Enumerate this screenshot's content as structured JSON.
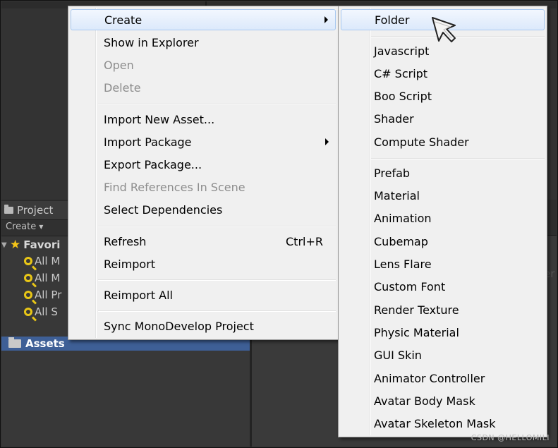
{
  "project_panel": {
    "tab_label": "Project",
    "create_label": "Create",
    "favorites_label": "Favori",
    "favorites_items": [
      "All M",
      "All M",
      "All Pr",
      "All S"
    ],
    "assets_label": "Assets",
    "right_ghost_text": "er"
  },
  "main_menu": {
    "items": [
      {
        "label": "Create",
        "has_submenu": true,
        "highlighted": true,
        "enabled": true
      },
      {
        "label": "Show in Explorer",
        "enabled": true
      },
      {
        "label": "Open",
        "enabled": false
      },
      {
        "label": "Delete",
        "enabled": false
      },
      {
        "label": "Import New Asset...",
        "enabled": true
      },
      {
        "label": "Import Package",
        "has_submenu": true,
        "enabled": true
      },
      {
        "label": "Export Package...",
        "enabled": true
      },
      {
        "label": "Find References In Scene",
        "enabled": false
      },
      {
        "label": "Select Dependencies",
        "enabled": true
      },
      {
        "label": "Refresh",
        "shortcut": "Ctrl+R",
        "enabled": true
      },
      {
        "label": "Reimport",
        "enabled": true
      },
      {
        "label": "Reimport All",
        "enabled": true
      },
      {
        "label": "Sync MonoDevelop Project",
        "enabled": true
      }
    ]
  },
  "create_submenu": {
    "items": [
      {
        "label": "Folder",
        "highlighted": true
      },
      {
        "label": "Javascript"
      },
      {
        "label": "C# Script"
      },
      {
        "label": "Boo Script"
      },
      {
        "label": "Shader"
      },
      {
        "label": "Compute Shader"
      },
      {
        "label": "Prefab"
      },
      {
        "label": "Material"
      },
      {
        "label": "Animation"
      },
      {
        "label": "Cubemap"
      },
      {
        "label": "Lens Flare"
      },
      {
        "label": "Custom Font"
      },
      {
        "label": "Render Texture"
      },
      {
        "label": "Physic Material"
      },
      {
        "label": "GUI Skin"
      },
      {
        "label": "Animator Controller"
      },
      {
        "label": "Avatar Body Mask"
      },
      {
        "label": "Avatar Skeleton Mask"
      }
    ]
  },
  "watermark": "CSDN @HELLOMILI",
  "colors": {
    "menu_bg": "#f0f0f0",
    "highlight_border": "#a8c8f0",
    "selection_blue": "#3e5f96",
    "editor_dark": "#383838"
  }
}
